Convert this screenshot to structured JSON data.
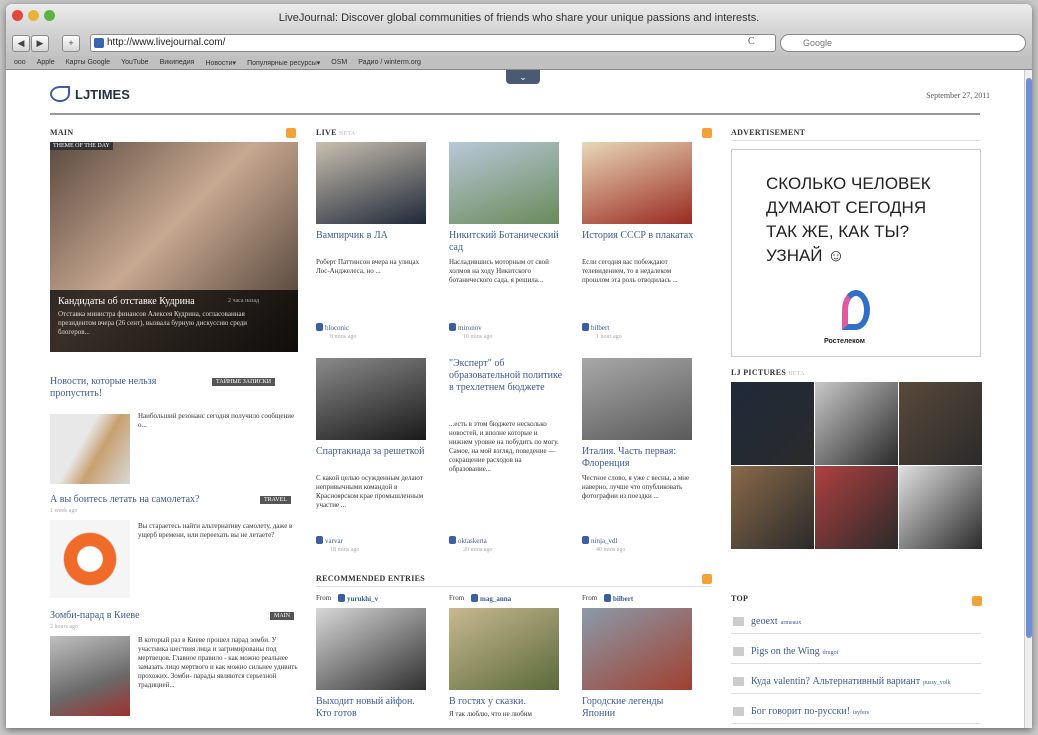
{
  "window": {
    "title": "LiveJournal: Discover global communities of friends who share your unique passions and interests."
  },
  "toolbar": {
    "back": "◀",
    "forward": "▶",
    "add": "+",
    "url": "http://www.livejournal.com/",
    "reload": "C",
    "search_placeholder": "Google"
  },
  "bookmarks": [
    "Apple",
    "Карты Google",
    "YouTube",
    "Википедия",
    "Новости▾",
    "Популярные ресурсы▾",
    "OSM",
    "Радио / winterm.org"
  ],
  "header": {
    "logo": "LJTIMES",
    "date": "September 27, 2011"
  },
  "sections": {
    "main": "MAIN",
    "live": "LIVE",
    "live_beta": "BETA",
    "ad": "ADVERTISEMENT",
    "pictures": "LJ PICTURES",
    "pictures_beta": "BETA",
    "recommended": "RECOMMENDED ENTRIES",
    "top": "TOP"
  },
  "main": {
    "theme_label": "THEME OF THE DAY",
    "feature_title": "Кандидаты об отставке Кудрина",
    "feature_ago": "2 часа назад",
    "feature_text": "Отставка министра финансов Алексея Кудрина, согласованная президентом вчера (26 сент), вызвала бурную дискуссию среди блогеров...",
    "items": [
      {
        "title": "Новости, которые нельзя пропустить!",
        "tag": "ТАЙНЫЕ ЗАПИСКИ",
        "text": "Наибольший резонанс сегодня получило сообщение о..."
      },
      {
        "title": "А вы боитесь летать на самолетах?",
        "tag": "TRAVEL",
        "ago": "1 week ago",
        "text": "Вы стараетесь найти альтернативу самолету, даже в ущерб времени, или переехать вы не летаете?"
      },
      {
        "title": "Зомби-парад в Киеве",
        "tag": "MAIN",
        "ago": "2 hours ago",
        "text": "В который раз в Киеве прошел парад зомби. У участника шествия лица и загримированы под мертвецов. Главное правило - как можно реальнее замазать лицо мертвого и как можно сильнее удивить прохожих. Зомби- парады являются серьезной традицией..."
      }
    ]
  },
  "live": [
    {
      "title": "Вампирчик в ЛА",
      "text": "Роберт Паттинсон вчера на улицах Лос-Анджелеса, но ...",
      "author": "bloconic",
      "ago": "8 mins ago",
      "colors": [
        "#c8c0b0",
        "#202838"
      ]
    },
    {
      "title": "Никитский Ботанический сад",
      "text": "Насладившись моторным от свой холмов на ходу Никитского ботанического сада, я решила...",
      "author": "mironov",
      "ago": "10 mins ago",
      "colors": [
        "#b8c8d8",
        "#6a8a5a"
      ]
    },
    {
      "title": "История СССР в плакатах",
      "text": "Если сегодня вас побеждают телевидением, то в недалеком прошлом эта роль отводилась ...",
      "author": "bilbert",
      "ago": "1 hour ago",
      "colors": [
        "#e8d8b8",
        "#9a2a20"
      ]
    },
    {
      "title": "Спартакиада за решеткой",
      "text": "С какой целью осужденным делают непривычными командой в Красноярском крае промышленным участие ...",
      "author": "varvar",
      "ago": "18 mins ago",
      "colors": [
        "#8a8a8a",
        "#1a1a1a"
      ]
    },
    {
      "title": "\"Эксперт\" об образовательной политике в трехлетнем бюджете",
      "text": "...есть в этом бюджете несколько новостей, и вполне которые и нижнем уровне на побудить по могу. Самое, на мой взгляд, поведение — сокращение расходов на образование...",
      "author": "oktaskerta",
      "ago": "20 mins ago",
      "colors": []
    },
    {
      "title": "Италия. Часть первая: Флоренция",
      "text": "Честное слово, я уже с весны, а мне наверно, лучше что опубликовать фотографии из поездки ...",
      "author": "ninja_vdl",
      "ago": "40 mins ago",
      "colors": [
        "#a8a8a8",
        "#5a5a5a"
      ]
    }
  ],
  "recommended": [
    {
      "from": "From",
      "user": "yurukhi_v",
      "title": "Выходит новый айфон. Кто готов",
      "colors": [
        "#d8d8d8",
        "#303030"
      ]
    },
    {
      "from": "From",
      "user": "mag_anna",
      "title": "В гостях у сказки.",
      "text": "Я так люблю, что не любим",
      "colors": [
        "#c8b890",
        "#5a6a3a"
      ]
    },
    {
      "from": "From",
      "user": "bilbert",
      "title": "Городские легенды Японии",
      "colors": [
        "#8a9aaa",
        "#a04030"
      ]
    }
  ],
  "ad": {
    "text": "СКОЛЬКО ЧЕЛОВЕК\nДУМАЮТ СЕГОДНЯ\nТАК ЖЕ, КАК ТЫ?\nУЗНАЙ ☺",
    "brand": "Ростелеком",
    "colors": {
      "blue": "#3070c8",
      "pink": "#e05aa0"
    }
  },
  "pictures": {
    "colors": [
      "#1e2a3a",
      "#c8c8c8",
      "#5a4a3a",
      "#8a6a4a",
      "#b04040",
      "#e0e0e0"
    ]
  },
  "top": [
    {
      "text": "geoext",
      "user": "armeaux"
    },
    {
      "text": "Pigs on the Wing",
      "user": "drugoi"
    },
    {
      "text": "Куда valentin? Альтернативный вариант",
      "user": "pussy_volk"
    },
    {
      "text": "Бог говорит по-русски!",
      "user": "tsyfers"
    }
  ],
  "colors": {
    "accent": "#3c5a9a",
    "rss": "#f3a23a",
    "scroll": "#6d8fd8"
  }
}
